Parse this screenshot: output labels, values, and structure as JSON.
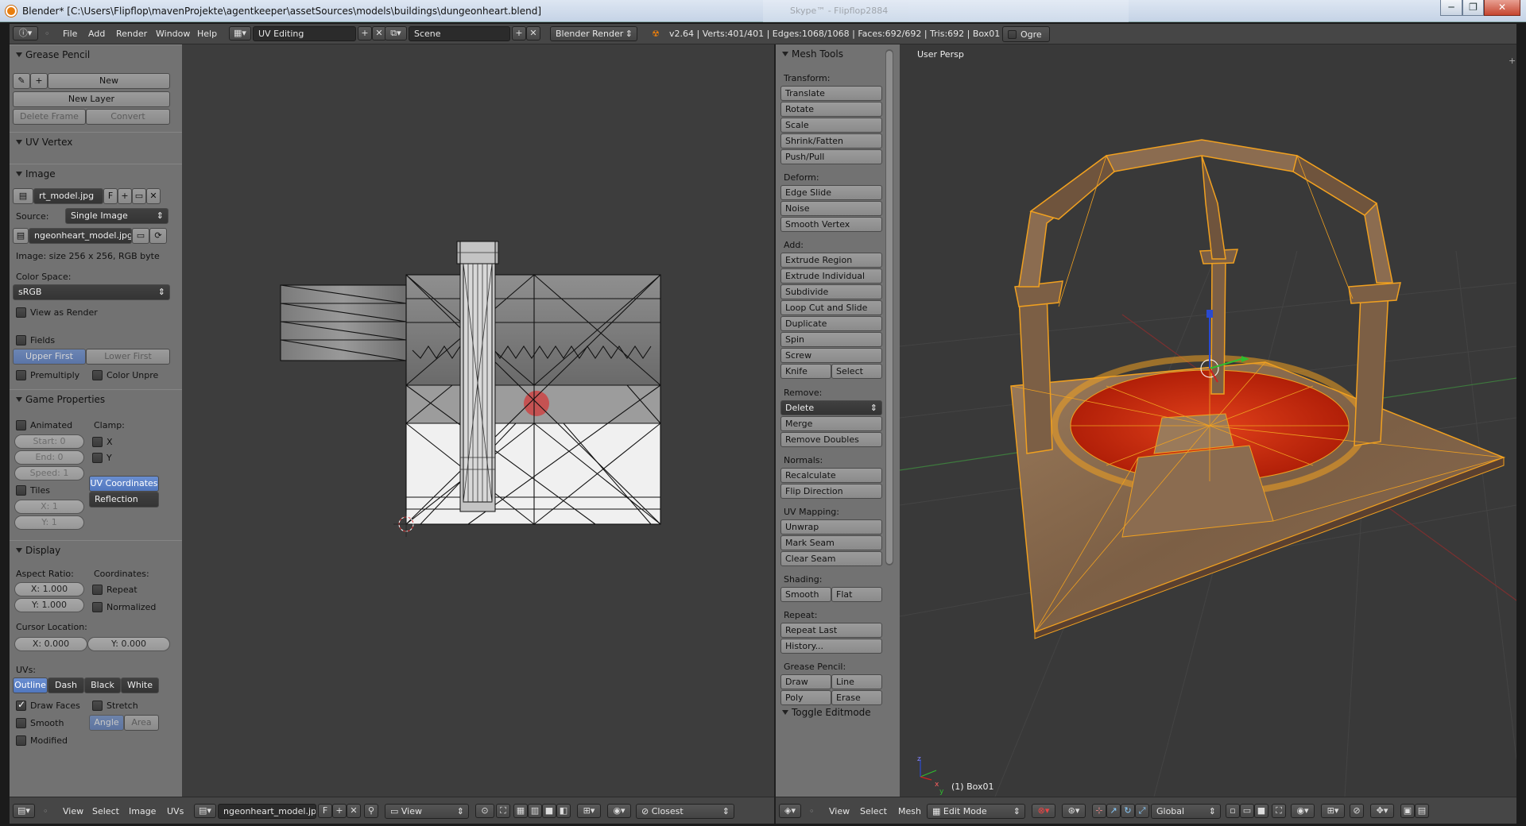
{
  "window": {
    "title": "Blender* [C:\\Users\\Flipflop\\mavenProjekte\\agentkeeper\\assetSources\\models\\buildings\\dungeonheart.blend]",
    "ghost_title": "Skype™ - Flipflop2884",
    "controls": [
      "─",
      "❐",
      "✕"
    ]
  },
  "header": {
    "menus": [
      "File",
      "Add",
      "Render",
      "Window",
      "Help"
    ],
    "screen_layout": "UV Editing",
    "scene": "Scene",
    "render_engine": "Blender Render",
    "stats": "v2.64 | Verts:401/401 | Edges:1068/1068 | Faces:692/692 | Tris:692 | Box01",
    "ogre_label": "Ogre"
  },
  "left_panel": {
    "grease_pencil": {
      "title": "Grease Pencil",
      "new": "New",
      "new_layer": "New Layer",
      "delete_frame": "Delete Frame",
      "convert": "Convert"
    },
    "uv_vertex": {
      "title": "UV Vertex"
    },
    "image": {
      "title": "Image",
      "image_name": "rt_model.jpg",
      "f_label": "F",
      "source_label": "Source:",
      "source_value": "Single Image",
      "file_path": "ngeonheart_model.jpg",
      "info": "Image: size 256 x 256, RGB byte",
      "color_space_label": "Color Space:",
      "color_space_value": "sRGB",
      "view_as_render": "View as Render",
      "fields": "Fields",
      "upper_first": "Upper First",
      "lower_first": "Lower First",
      "premultiply": "Premultiply",
      "color_unpre": "Color Unpre"
    },
    "game_properties": {
      "title": "Game Properties",
      "animated": "Animated",
      "clamp": "Clamp:",
      "start": "Start: 0",
      "end": "End: 0",
      "speed": "Speed: 1",
      "x": "X",
      "y": "Y",
      "uv_coordinates": "UV Coordinates",
      "reflection": "Reflection",
      "tiles": "Tiles",
      "tile_x": "X: 1",
      "tile_y": "Y: 1"
    },
    "display": {
      "title": "Display",
      "aspect_ratio": "Aspect Ratio:",
      "coordinates": "Coordinates:",
      "aspect_x": "X: 1.000",
      "aspect_y": "Y: 1.000",
      "repeat": "Repeat",
      "normalized": "Normalized",
      "cursor_location": "Cursor Location:",
      "cursor_x": "X: 0.000",
      "cursor_y": "Y: 0.000",
      "uvs": "UVs:",
      "uv_modes": [
        "Outline",
        "Dash",
        "Black",
        "White"
      ],
      "draw_faces": "Draw Faces",
      "stretch": "Stretch",
      "smooth": "Smooth",
      "angle": "Angle",
      "area": "Area",
      "modified": "Modified"
    }
  },
  "mesh_tools": {
    "title": "Mesh Tools",
    "transform_label": "Transform:",
    "transform": [
      "Translate",
      "Rotate",
      "Scale",
      "Shrink/Fatten",
      "Push/Pull"
    ],
    "deform_label": "Deform:",
    "deform": [
      "Edge Slide",
      "Noise",
      "Smooth Vertex"
    ],
    "add_label": "Add:",
    "add": [
      "Extrude Region",
      "Extrude Individual",
      "Subdivide",
      "Loop Cut and Slide",
      "Duplicate",
      "Spin",
      "Screw"
    ],
    "knife": "Knife",
    "select": "Select",
    "remove_label": "Remove:",
    "delete": "Delete",
    "remove": [
      "Merge",
      "Remove Doubles"
    ],
    "normals_label": "Normals:",
    "normals": [
      "Recalculate",
      "Flip Direction"
    ],
    "uvmap_label": "UV Mapping:",
    "uvmap": [
      "Unwrap",
      "Mark Seam",
      "Clear Seam"
    ],
    "shading_label": "Shading:",
    "smooth": "Smooth",
    "flat": "Flat",
    "repeat_label": "Repeat:",
    "repeat": [
      "Repeat Last",
      "History..."
    ],
    "grease_label": "Grease Pencil:",
    "draw": "Draw",
    "line": "Line",
    "poly": "Poly",
    "erase": "Erase",
    "toggle_editmode": "Toggle Editmode"
  },
  "viewport": {
    "label": "User Persp",
    "object": "(1) Box01",
    "axis_x": "x",
    "axis_y": "y",
    "axis_z": "z"
  },
  "uv_header": {
    "menus": [
      "View",
      "Select",
      "Image",
      "UVs"
    ],
    "image_name": "ngeonheart_model.jpg",
    "f_label": "F",
    "view_mode": "View",
    "pivot": "Closest"
  },
  "view3d_header": {
    "menus": [
      "View",
      "Select",
      "Mesh"
    ],
    "mode": "Edit Mode",
    "orientation": "Global"
  },
  "colors": {
    "wire_selected": "#f0a020",
    "face_red": "#c8260a",
    "ui_panel": "#727272",
    "ui_dark": "#393939",
    "accent_blue": "#5680c2"
  }
}
